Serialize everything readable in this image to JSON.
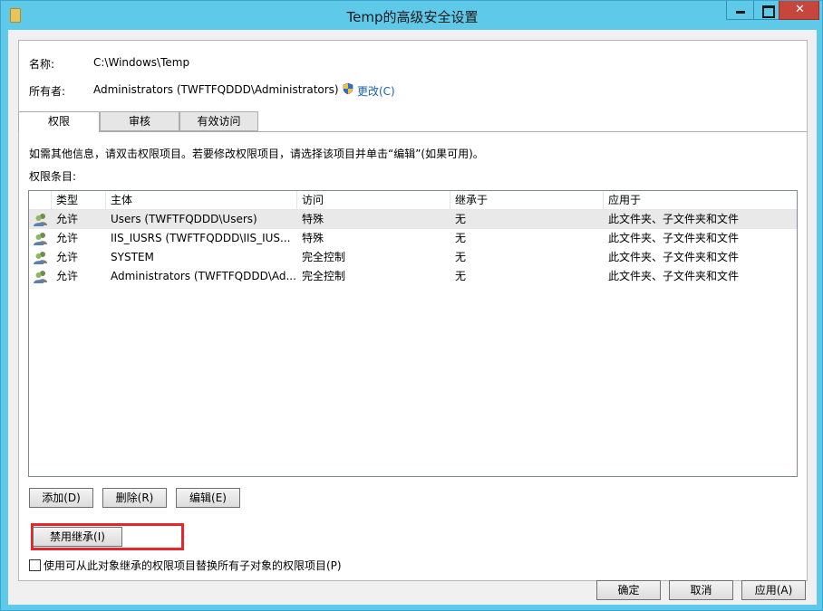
{
  "window": {
    "title": "Temp的高级安全设置"
  },
  "info": {
    "name_label": "名称:",
    "name_value": "C:\\Windows\\Temp",
    "owner_label": "所有者:",
    "owner_value": "Administrators (TWFTFQDDD\\Administrators)",
    "change_link": "更改(C)"
  },
  "tabs": [
    {
      "label": "权限",
      "active": true
    },
    {
      "label": "审核",
      "active": false
    },
    {
      "label": "有效访问",
      "active": false
    }
  ],
  "permissions": {
    "hint": "如需其他信息，请双击权限项目。若要修改权限项目，请选择该项目并单击“编辑”(如果可用)。",
    "entries_label": "权限条目:",
    "columns": [
      "类型",
      "主体",
      "访问",
      "继承于",
      "应用于"
    ],
    "rows": [
      {
        "type": "允许",
        "principal": "Users (TWFTFQDDD\\Users)",
        "access": "特殊",
        "inherited": "无",
        "applies": "此文件夹、子文件夹和文件",
        "icon": "users-icon"
      },
      {
        "type": "允许",
        "principal": "IIS_IUSRS (TWFTFQDDD\\IIS_IUS...",
        "access": "特殊",
        "inherited": "无",
        "applies": "此文件夹、子文件夹和文件",
        "icon": "users-icon"
      },
      {
        "type": "允许",
        "principal": "SYSTEM",
        "access": "完全控制",
        "inherited": "无",
        "applies": "此文件夹、子文件夹和文件",
        "icon": "users-icon"
      },
      {
        "type": "允许",
        "principal": "Administrators (TWFTFQDDD\\Ad...",
        "access": "完全控制",
        "inherited": "无",
        "applies": "此文件夹、子文件夹和文件",
        "icon": "users-icon"
      }
    ]
  },
  "actions": {
    "add": "添加(D)",
    "remove": "删除(R)",
    "edit": "编辑(E)",
    "disable_inheritance": "禁用继承(I)",
    "replace_checkbox": "使用可从此对象继承的权限项目替换所有子对象的权限项目(P)"
  },
  "footer": {
    "ok": "确定",
    "cancel": "取消",
    "apply": "应用(A)"
  },
  "colors": {
    "titlebar": "#5fc9ea",
    "close_button": "#c7463b",
    "highlight": "#e8252b",
    "link": "#1a5fb4"
  }
}
